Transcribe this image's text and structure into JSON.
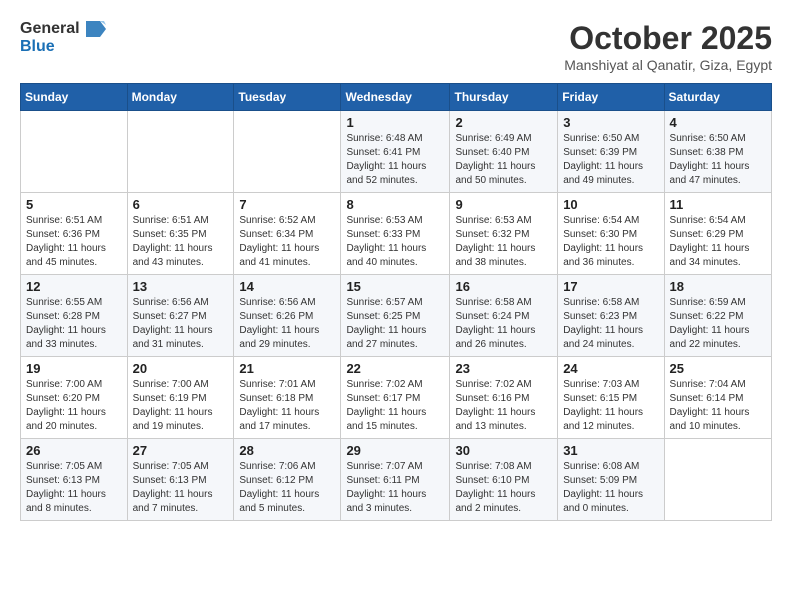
{
  "logo": {
    "line1": "General",
    "line2": "Blue"
  },
  "title": "October 2025",
  "location": "Manshiyat al Qanatir, Giza, Egypt",
  "weekdays": [
    "Sunday",
    "Monday",
    "Tuesday",
    "Wednesday",
    "Thursday",
    "Friday",
    "Saturday"
  ],
  "weeks": [
    [
      {
        "day": "",
        "info": ""
      },
      {
        "day": "",
        "info": ""
      },
      {
        "day": "",
        "info": ""
      },
      {
        "day": "1",
        "info": "Sunrise: 6:48 AM\nSunset: 6:41 PM\nDaylight: 11 hours\nand 52 minutes."
      },
      {
        "day": "2",
        "info": "Sunrise: 6:49 AM\nSunset: 6:40 PM\nDaylight: 11 hours\nand 50 minutes."
      },
      {
        "day": "3",
        "info": "Sunrise: 6:50 AM\nSunset: 6:39 PM\nDaylight: 11 hours\nand 49 minutes."
      },
      {
        "day": "4",
        "info": "Sunrise: 6:50 AM\nSunset: 6:38 PM\nDaylight: 11 hours\nand 47 minutes."
      }
    ],
    [
      {
        "day": "5",
        "info": "Sunrise: 6:51 AM\nSunset: 6:36 PM\nDaylight: 11 hours\nand 45 minutes."
      },
      {
        "day": "6",
        "info": "Sunrise: 6:51 AM\nSunset: 6:35 PM\nDaylight: 11 hours\nand 43 minutes."
      },
      {
        "day": "7",
        "info": "Sunrise: 6:52 AM\nSunset: 6:34 PM\nDaylight: 11 hours\nand 41 minutes."
      },
      {
        "day": "8",
        "info": "Sunrise: 6:53 AM\nSunset: 6:33 PM\nDaylight: 11 hours\nand 40 minutes."
      },
      {
        "day": "9",
        "info": "Sunrise: 6:53 AM\nSunset: 6:32 PM\nDaylight: 11 hours\nand 38 minutes."
      },
      {
        "day": "10",
        "info": "Sunrise: 6:54 AM\nSunset: 6:30 PM\nDaylight: 11 hours\nand 36 minutes."
      },
      {
        "day": "11",
        "info": "Sunrise: 6:54 AM\nSunset: 6:29 PM\nDaylight: 11 hours\nand 34 minutes."
      }
    ],
    [
      {
        "day": "12",
        "info": "Sunrise: 6:55 AM\nSunset: 6:28 PM\nDaylight: 11 hours\nand 33 minutes."
      },
      {
        "day": "13",
        "info": "Sunrise: 6:56 AM\nSunset: 6:27 PM\nDaylight: 11 hours\nand 31 minutes."
      },
      {
        "day": "14",
        "info": "Sunrise: 6:56 AM\nSunset: 6:26 PM\nDaylight: 11 hours\nand 29 minutes."
      },
      {
        "day": "15",
        "info": "Sunrise: 6:57 AM\nSunset: 6:25 PM\nDaylight: 11 hours\nand 27 minutes."
      },
      {
        "day": "16",
        "info": "Sunrise: 6:58 AM\nSunset: 6:24 PM\nDaylight: 11 hours\nand 26 minutes."
      },
      {
        "day": "17",
        "info": "Sunrise: 6:58 AM\nSunset: 6:23 PM\nDaylight: 11 hours\nand 24 minutes."
      },
      {
        "day": "18",
        "info": "Sunrise: 6:59 AM\nSunset: 6:22 PM\nDaylight: 11 hours\nand 22 minutes."
      }
    ],
    [
      {
        "day": "19",
        "info": "Sunrise: 7:00 AM\nSunset: 6:20 PM\nDaylight: 11 hours\nand 20 minutes."
      },
      {
        "day": "20",
        "info": "Sunrise: 7:00 AM\nSunset: 6:19 PM\nDaylight: 11 hours\nand 19 minutes."
      },
      {
        "day": "21",
        "info": "Sunrise: 7:01 AM\nSunset: 6:18 PM\nDaylight: 11 hours\nand 17 minutes."
      },
      {
        "day": "22",
        "info": "Sunrise: 7:02 AM\nSunset: 6:17 PM\nDaylight: 11 hours\nand 15 minutes."
      },
      {
        "day": "23",
        "info": "Sunrise: 7:02 AM\nSunset: 6:16 PM\nDaylight: 11 hours\nand 13 minutes."
      },
      {
        "day": "24",
        "info": "Sunrise: 7:03 AM\nSunset: 6:15 PM\nDaylight: 11 hours\nand 12 minutes."
      },
      {
        "day": "25",
        "info": "Sunrise: 7:04 AM\nSunset: 6:14 PM\nDaylight: 11 hours\nand 10 minutes."
      }
    ],
    [
      {
        "day": "26",
        "info": "Sunrise: 7:05 AM\nSunset: 6:13 PM\nDaylight: 11 hours\nand 8 minutes."
      },
      {
        "day": "27",
        "info": "Sunrise: 7:05 AM\nSunset: 6:13 PM\nDaylight: 11 hours\nand 7 minutes."
      },
      {
        "day": "28",
        "info": "Sunrise: 7:06 AM\nSunset: 6:12 PM\nDaylight: 11 hours\nand 5 minutes."
      },
      {
        "day": "29",
        "info": "Sunrise: 7:07 AM\nSunset: 6:11 PM\nDaylight: 11 hours\nand 3 minutes."
      },
      {
        "day": "30",
        "info": "Sunrise: 7:08 AM\nSunset: 6:10 PM\nDaylight: 11 hours\nand 2 minutes."
      },
      {
        "day": "31",
        "info": "Sunrise: 6:08 AM\nSunset: 5:09 PM\nDaylight: 11 hours\nand 0 minutes."
      },
      {
        "day": "",
        "info": ""
      }
    ]
  ]
}
